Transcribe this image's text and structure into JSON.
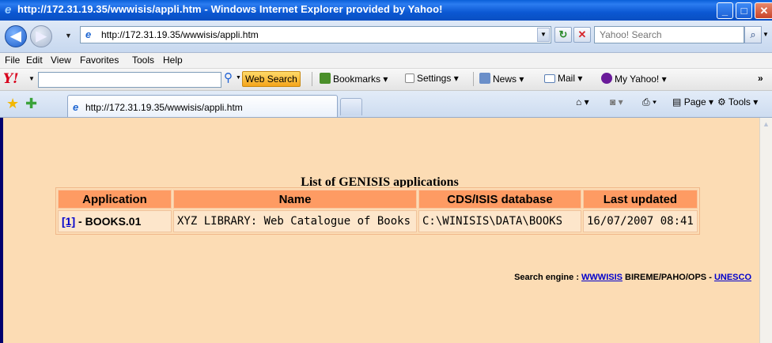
{
  "window": {
    "title": "http://172.31.19.35/wwwisis/appli.htm - Windows Internet Explorer provided by Yahoo!"
  },
  "addressbar": {
    "url": "http://172.31.19.35/wwwisis/appli.htm",
    "search_placeholder": "Yahoo! Search"
  },
  "menu": [
    "File",
    "Edit",
    "View",
    "Favorites",
    "Tools",
    "Help"
  ],
  "yahoo_toolbar": {
    "web_search": "Web Search",
    "bookmarks": "Bookmarks",
    "settings": "Settings",
    "news": "News",
    "mail": "Mail",
    "my_yahoo": "My Yahoo!"
  },
  "tabs": {
    "active_tab": "http://172.31.19.35/wwwisis/appli.htm",
    "page_label": "Page",
    "tools_label": "Tools"
  },
  "page": {
    "title": "List of GENISIS applications",
    "columns": [
      "Application",
      "Name",
      "CDS/ISIS database",
      "Last updated"
    ],
    "rows": [
      {
        "link": "[1]",
        "sep": "-",
        "app": "BOOKS.01",
        "name": "XYZ LIBRARY: Web Catalogue of Books",
        "database": "C:\\WINISIS\\DATA\\BOOKS",
        "updated": "16/07/2007 08:41"
      }
    ],
    "footer": {
      "prefix": "Search engine :",
      "wwwisis": "WWWISIS",
      "org": "BIREME/PAHO/OPS",
      "dash": "-",
      "unesco": "UNESCO"
    }
  }
}
